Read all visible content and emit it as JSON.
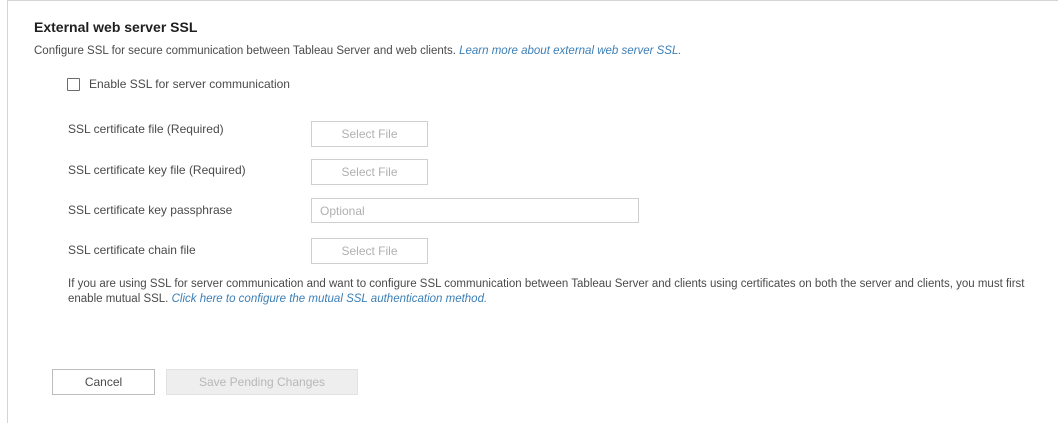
{
  "section": {
    "title": "External web server SSL",
    "description": "Configure SSL for secure communication between Tableau Server and web clients.",
    "learn_more_link": "Learn more about external web server SSL."
  },
  "enable_ssl": {
    "label": "Enable SSL for server communication",
    "checked": false
  },
  "fields": {
    "cert_file": {
      "label": "SSL certificate file (Required)",
      "button": "Select File"
    },
    "key_file": {
      "label": "SSL certificate key file (Required)",
      "button": "Select File"
    },
    "passphrase": {
      "label": "SSL certificate key passphrase",
      "placeholder": "Optional",
      "value": ""
    },
    "chain_file": {
      "label": "SSL certificate chain file",
      "button": "Select File"
    }
  },
  "note": {
    "text": "If you are using SSL for server communication and want to configure SSL communication between Tableau Server and clients using certificates on both the server and clients, you must first enable mutual SSL.",
    "link": "Click here to configure the mutual SSL authentication method."
  },
  "actions": {
    "cancel": "Cancel",
    "save": "Save Pending Changes"
  },
  "colors": {
    "link": "#3b7fb6",
    "text": "#4a4a4a",
    "border": "#cfcfcf",
    "disabled_button_bg": "#eeeeee"
  }
}
